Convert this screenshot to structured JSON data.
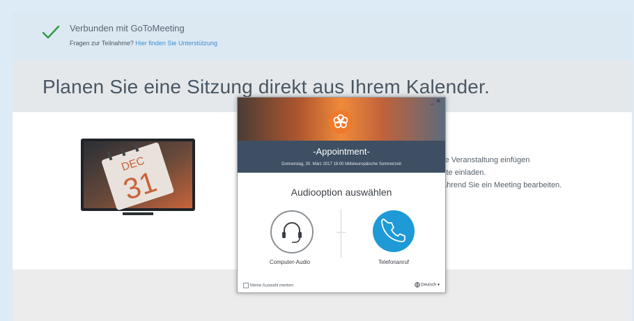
{
  "banner": {
    "title": "Verbunden mit GoToMeeting",
    "question": "Fragen zur Teilnahme?",
    "help_link": "Hier finden Sie Unterstützung"
  },
  "headline": "Planen Sie eine Sitzung direkt aus Ihrem Kalender.",
  "calendar_graphic": {
    "month": "DEC",
    "day": "31"
  },
  "side_text": {
    "line1": "re Veranstaltung einfügen",
    "line2": "kte einladen.",
    "line3": "ährend Sie ein Meeting bearbeiten."
  },
  "dialog": {
    "title": "-Appointment-",
    "date": "Donnerstag, 30. März 2017    16:00 Mitteleuropäische Sommerzeit",
    "heading": "Audiooption auswählen",
    "option_computer": "Computer-Audio",
    "option_phone": "Telefonanruf",
    "remember_label": "Meine Auswahl merken",
    "language": "Deutsch",
    "controls": "_ ✕"
  },
  "colors": {
    "accent_blue": "#1e9ad6",
    "logo_orange": "#f07a2c",
    "check_green": "#2e9a3c",
    "banner_bg": "#dce9f3"
  }
}
